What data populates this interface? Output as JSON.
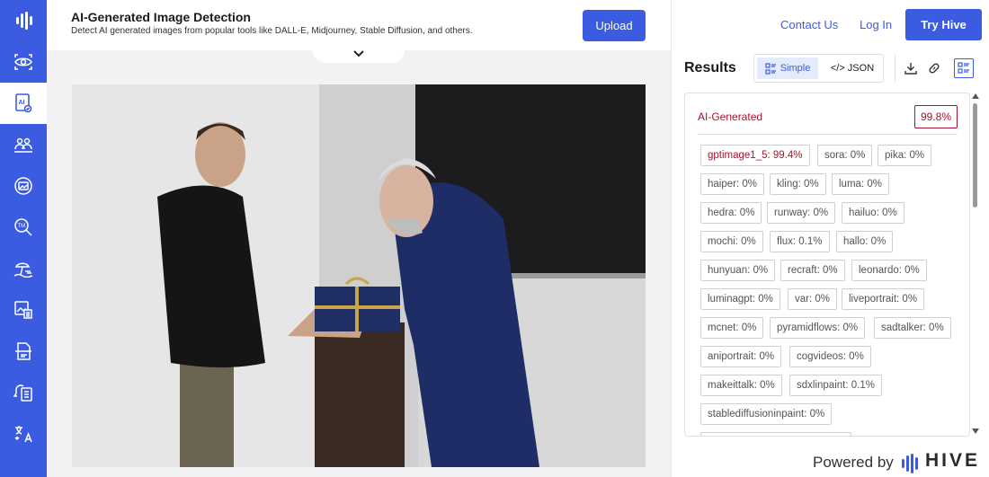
{
  "sidebar": {
    "colors": {
      "background": "#3b5be0",
      "active_bg": "#ffffff"
    },
    "items": [
      {
        "icon": "hive-logo-icon",
        "active": false
      },
      {
        "icon": "eye-scan-icon",
        "active": false
      },
      {
        "icon": "ai-document-icon",
        "active": true
      },
      {
        "icon": "people-detection-icon",
        "active": false
      },
      {
        "icon": "image-moderation-icon",
        "active": false
      },
      {
        "icon": "trademark-search-icon",
        "active": false
      },
      {
        "icon": "beach-scene-icon",
        "active": false
      },
      {
        "icon": "image-text-icon",
        "active": false
      },
      {
        "icon": "document-scan-icon",
        "active": false
      },
      {
        "icon": "speech-document-icon",
        "active": false
      },
      {
        "icon": "translate-icon",
        "active": false
      }
    ]
  },
  "header": {
    "title": "AI-Generated Image Detection",
    "subtitle": "Detect AI generated images from popular tools like DALL-E, Midjourney, Stable Diffusion, and others.",
    "upload_label": "Upload"
  },
  "nav": {
    "contact_label": "Contact Us",
    "login_label": "Log In",
    "try_label": "Try Hive"
  },
  "results": {
    "title": "Results",
    "simple_label": "Simple",
    "json_label": "</> JSON",
    "class_label": "AI-Generated",
    "class_score": "99.8%",
    "tags": [
      "gptimage1_5: 99.4%",
      "sora: 0%",
      "pika: 0%",
      "haiper: 0%",
      "kling: 0%",
      "luma: 0%",
      "hedra: 0%",
      "runway: 0%",
      "hailuo: 0%",
      "mochi: 0%",
      "flux: 0.1%",
      "hallo: 0%",
      "hunyuan: 0%",
      "recraft: 0%",
      "leonardo: 0%",
      "luminagpt: 0%",
      "var: 0%",
      "liveportrait: 0%",
      "mcnet: 0%",
      "pyramidflows: 0%",
      "sadtalker: 0%",
      "aniportrait: 0%",
      "cogvideos: 0%",
      "makeittalk: 0%",
      "sdxlinpaint: 0.1%",
      "stablediffusioninpaint: 0%"
    ]
  },
  "footer": {
    "powered_label": "Powered by",
    "brand": "HIVE"
  },
  "colors": {
    "accent": "#3b5be0",
    "alert": "#a8152a"
  }
}
